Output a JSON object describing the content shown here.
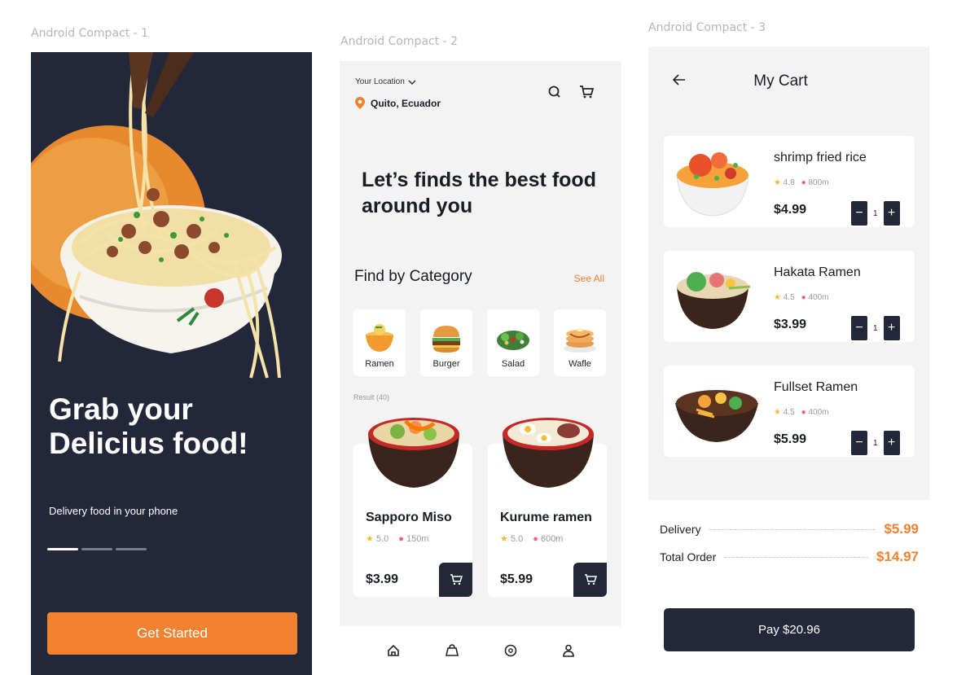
{
  "frames": {
    "one": "Android Compact - 1",
    "two": "Android Compact - 2",
    "three": "Android Compact - 3"
  },
  "screen1": {
    "title": "Grab your Delicius food!",
    "subtitle": "Delivery food in your phone",
    "cta": "Get Started",
    "pager": {
      "pages": 3,
      "active": 1
    }
  },
  "screen2": {
    "location_label": "Your Location",
    "location_value": "Quito, Ecuador",
    "headline": "Let’s finds the best food around you",
    "category_title": "Find by Category",
    "see_all": "See All",
    "categories": [
      {
        "label": "Ramen",
        "icon": "ramen-icon"
      },
      {
        "label": "Burger",
        "icon": "burger-icon"
      },
      {
        "label": "Salad",
        "icon": "salad-icon"
      },
      {
        "label": "Wafle",
        "icon": "waffle-icon"
      }
    ],
    "result": "Result (40)",
    "products": [
      {
        "name": "Sapporo Miso",
        "rating": "5.0",
        "distance": "150m",
        "price": "$3.99"
      },
      {
        "name": "Kurume ramen",
        "rating": "5.0",
        "distance": "600m",
        "price": "$5.99"
      }
    ],
    "nav_icons": [
      "home-icon",
      "bag-icon",
      "compass-icon",
      "profile-icon"
    ]
  },
  "screen3": {
    "title": "My Cart",
    "items": [
      {
        "name": "shrimp fried rice",
        "rating": "4.8",
        "distance": "800m",
        "price": "$4.99",
        "qty": "1"
      },
      {
        "name": "Hakata Ramen",
        "rating": "4.5",
        "distance": "400m",
        "price": "$3.99",
        "qty": "1"
      },
      {
        "name": "Fullset Ramen",
        "rating": "4.5",
        "distance": "400m",
        "price": "$5.99",
        "qty": "1"
      }
    ],
    "delivery_label": "Delivery",
    "delivery_value": "$5.99",
    "total_label": "Total Order",
    "total_value": "$14.97",
    "pay": "Pay $20.96"
  },
  "colors": {
    "accent": "#f2822f",
    "dark": "#23273a",
    "background": "#f3f3f3",
    "star": "#f7b43a",
    "pin": "#f05c8b"
  }
}
